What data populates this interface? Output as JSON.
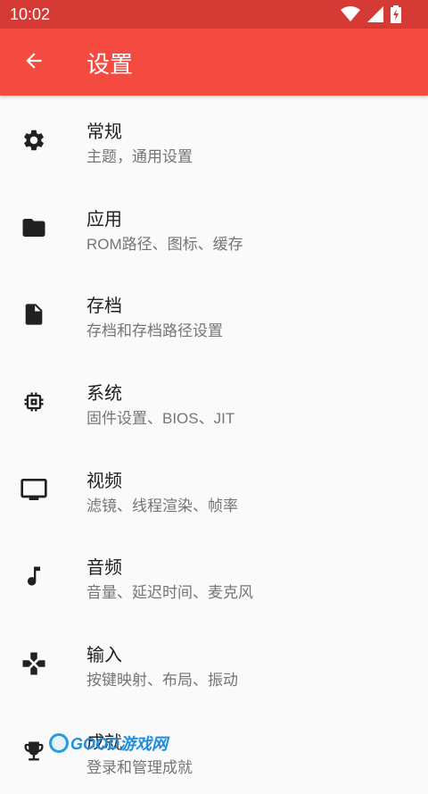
{
  "status_bar": {
    "time": "10:02",
    "icons": [
      "wifi-icon",
      "signal-icon",
      "battery-charging-icon"
    ]
  },
  "app_bar": {
    "title": "设置",
    "back_icon": "arrow-back-icon"
  },
  "settings": [
    {
      "icon": "gear-icon",
      "label": "常规",
      "sub": "主题，通用设置"
    },
    {
      "icon": "folder-icon",
      "label": "应用",
      "sub": "ROM路径、图标、缓存"
    },
    {
      "icon": "file-icon",
      "label": "存档",
      "sub": "存档和存档路径设置"
    },
    {
      "icon": "chip-icon",
      "label": "系统",
      "sub": "固件设置、BIOS、JIT"
    },
    {
      "icon": "monitor-icon",
      "label": "视频",
      "sub": "滤镜、线程渲染、帧率"
    },
    {
      "icon": "music-note-icon",
      "label": "音频",
      "sub": "音量、延迟时间、麦克风"
    },
    {
      "icon": "gamepad-icon",
      "label": "输入",
      "sub": "按键映射、布局、振动"
    },
    {
      "icon": "trophy-icon",
      "label": "成就",
      "sub": "登录和管理成就"
    }
  ],
  "watermark": {
    "text": "GOOD游戏网"
  },
  "colors": {
    "app_bar": "#f44a40",
    "status_bar": "#d63a34",
    "background": "#fafafa"
  }
}
